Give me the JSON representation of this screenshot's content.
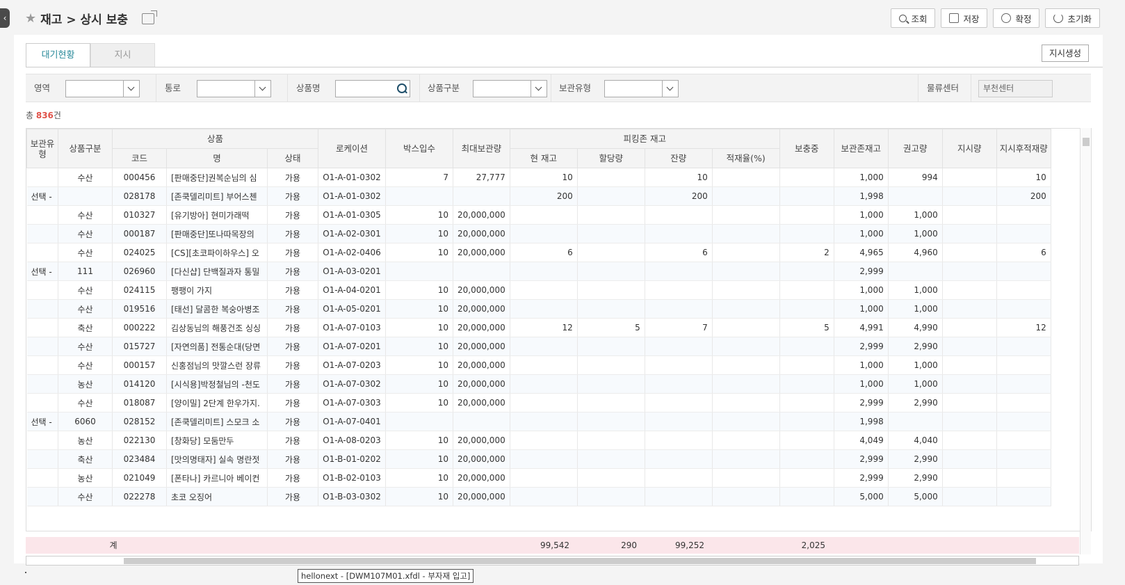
{
  "header": {
    "breadcrumb": "재고 > 상시 보충"
  },
  "toolbar": {
    "search": "조회",
    "save": "저장",
    "confirm": "확정",
    "reset": "초기화"
  },
  "tabs": [
    "대기현황",
    "지시"
  ],
  "gen_button": "지시생성",
  "filters": {
    "area": "영역",
    "aisle": "통로",
    "product_name": "상품명",
    "product_type": "상품구분",
    "storage_type": "보관유형",
    "center_label": "물류센터",
    "center_value": "부천센터"
  },
  "total": {
    "prefix": "총 ",
    "count": "836",
    "suffix": "건"
  },
  "columns": {
    "storage_type": "보관유형",
    "product_type": "상품구분",
    "product": "상품",
    "code": "코드",
    "name": "명",
    "status": "상태",
    "location": "로케이션",
    "box": "박스입수",
    "max": "최대보관량",
    "picking": "피킹존 재고",
    "current": "현 재고",
    "allocated": "할당량",
    "remain": "잔량",
    "load_rate": "적재율(%)",
    "replenishing": "보충중",
    "storage_stock": "보관존재고",
    "recommend": "권고량",
    "instruct": "지시량",
    "after": "지시후적재량"
  },
  "rows": [
    [
      "",
      "수산",
      "000456",
      "[판매중단]권복순님의 심",
      "가용",
      "O1-A-01-0302",
      "7",
      "27,777",
      "10",
      "",
      "10",
      "",
      "",
      "1,000",
      "994",
      "",
      "10"
    ],
    [
      "선택 -",
      "",
      "028178",
      "[존쿡델리미트] 부어스첸",
      "가용",
      "O1-A-01-0302",
      "",
      "",
      "200",
      "",
      "200",
      "",
      "",
      "1,998",
      "",
      "",
      "200"
    ],
    [
      "",
      "수산",
      "010327",
      "[유기방아] 현미가래떡",
      "가용",
      "O1-A-01-0305",
      "10",
      "20,000,000",
      "",
      "",
      "",
      "",
      "",
      "1,000",
      "1,000",
      "",
      ""
    ],
    [
      "",
      "수산",
      "000187",
      "[판매중단]또나따목장의",
      "가용",
      "O1-A-02-0301",
      "10",
      "20,000,000",
      "",
      "",
      "",
      "",
      "",
      "1,000",
      "1,000",
      "",
      ""
    ],
    [
      "",
      "수산",
      "024025",
      "[CS][초코파이하우스] 오",
      "가용",
      "O1-A-02-0406",
      "10",
      "20,000,000",
      "6",
      "",
      "6",
      "",
      "2",
      "4,965",
      "4,960",
      "",
      "6"
    ],
    [
      "선택 -",
      "111",
      "026960",
      "[다신샵] 단백질과자 통밀",
      "가용",
      "O1-A-03-0201",
      "",
      "",
      "",
      "",
      "",
      "",
      "",
      "2,999",
      "",
      "",
      ""
    ],
    [
      "",
      "수산",
      "024115",
      "팽팽이 가지",
      "가용",
      "O1-A-04-0201",
      "10",
      "20,000,000",
      "",
      "",
      "",
      "",
      "",
      "1,000",
      "1,000",
      "",
      ""
    ],
    [
      "",
      "수산",
      "019516",
      "[태선] 달콤한 복숭아병조",
      "가용",
      "O1-A-05-0201",
      "10",
      "20,000,000",
      "",
      "",
      "",
      "",
      "",
      "1,000",
      "1,000",
      "",
      ""
    ],
    [
      "",
      "축산",
      "000222",
      "김상동님의 해풍건조 싱싱",
      "가용",
      "O1-A-07-0103",
      "10",
      "20,000,000",
      "12",
      "5",
      "7",
      "",
      "5",
      "4,991",
      "4,990",
      "",
      "12"
    ],
    [
      "",
      "수산",
      "015727",
      "[자연의품] 전통순대(당면",
      "가용",
      "O1-A-07-0201",
      "10",
      "20,000,000",
      "",
      "",
      "",
      "",
      "",
      "2,999",
      "2,990",
      "",
      ""
    ],
    [
      "",
      "수산",
      "000157",
      "신홍점님의 맛깔스런 장류",
      "가용",
      "O1-A-07-0203",
      "10",
      "20,000,000",
      "",
      "",
      "",
      "",
      "",
      "1,000",
      "1,000",
      "",
      ""
    ],
    [
      "",
      "농산",
      "014120",
      "[시식용]박정철님의 -천도",
      "가용",
      "O1-A-07-0302",
      "10",
      "20,000,000",
      "",
      "",
      "",
      "",
      "",
      "1,000",
      "1,000",
      "",
      ""
    ],
    [
      "",
      "수산",
      "018087",
      "[양이밀] 2단계 한우가지.",
      "가용",
      "O1-A-07-0303",
      "10",
      "20,000,000",
      "",
      "",
      "",
      "",
      "",
      "2,999",
      "2,990",
      "",
      ""
    ],
    [
      "선택 -",
      "6060",
      "028152",
      "[존쿡델리미트] 스모크 소",
      "가용",
      "O1-A-07-0401",
      "",
      "",
      "",
      "",
      "",
      "",
      "",
      "1,998",
      "",
      "",
      ""
    ],
    [
      "",
      "농산",
      "022130",
      "[창화당] 모둠만두",
      "가용",
      "O1-A-08-0203",
      "10",
      "20,000,000",
      "",
      "",
      "",
      "",
      "",
      "4,049",
      "4,040",
      "",
      ""
    ],
    [
      "",
      "축산",
      "023484",
      "[맛의명태자] 실속 명란젓",
      "가용",
      "O1-B-01-0202",
      "10",
      "20,000,000",
      "",
      "",
      "",
      "",
      "",
      "2,999",
      "2,990",
      "",
      ""
    ],
    [
      "",
      "농산",
      "021049",
      "[폰타나] 카르니아 베이컨",
      "가용",
      "O1-B-02-0103",
      "10",
      "20,000,000",
      "",
      "",
      "",
      "",
      "",
      "2,999",
      "2,990",
      "",
      ""
    ],
    [
      "",
      "수산",
      "022278",
      "초코 오징어",
      "가용",
      "O1-B-03-0302",
      "10",
      "20,000,000",
      "",
      "",
      "",
      "",
      "",
      "5,000",
      "5,000",
      "",
      ""
    ]
  ],
  "summary": {
    "label": "계",
    "current": "99,542",
    "allocated": "290",
    "remain": "99,252",
    "replenishing": "2,025"
  },
  "statusbar": "hellonext - [DWM107M01.xfdl - 부자재 입고]"
}
